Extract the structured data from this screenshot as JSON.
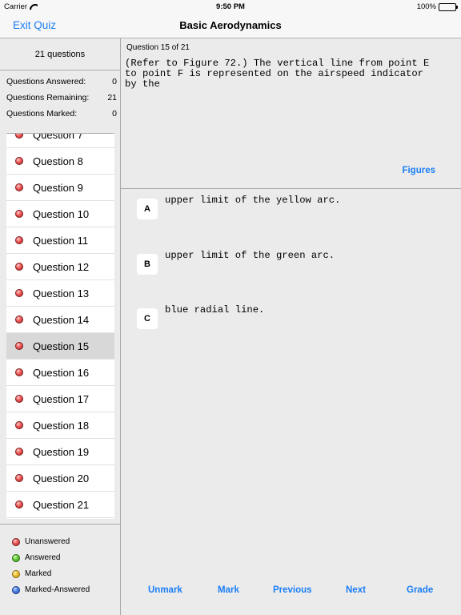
{
  "status_bar": {
    "carrier": "Carrier",
    "time": "9:50 PM",
    "battery": "100%",
    "battery_level": 1.0,
    "wifi_icon": "wifi-icon",
    "battery_icon": "battery-icon"
  },
  "nav": {
    "exit_label": "Exit Quiz",
    "title": "Basic Aerodynamics"
  },
  "sidebar": {
    "question_count": "21 questions",
    "stats": [
      {
        "label": "Questions Answered:",
        "value": "0"
      },
      {
        "label": "Questions Remaining:",
        "value": "21"
      },
      {
        "label": "Questions Marked:",
        "value": "0"
      }
    ],
    "questions": [
      "Question 7",
      "Question 8",
      "Question 9",
      "Question 10",
      "Question 11",
      "Question 12",
      "Question 13",
      "Question 14",
      "Question 15",
      "Question 16",
      "Question 17",
      "Question 18",
      "Question 19",
      "Question 20",
      "Question 21"
    ],
    "selected_question": "Question 15",
    "legend": [
      {
        "label": "Unanswered",
        "color": "red"
      },
      {
        "label": "Answered",
        "color": "green"
      },
      {
        "label": "Marked",
        "color": "yellow"
      },
      {
        "label": "Marked-Answered",
        "color": "blue"
      }
    ]
  },
  "question": {
    "number_label": "Question 15 of 21",
    "text_lines": [
      "(Refer to Figure 72.) The vertical line from point E",
      "to point F is represented on the airspeed indicator",
      "by the"
    ],
    "figures_label": "Figures"
  },
  "answers": [
    {
      "letter": "A",
      "text": "upper limit of the yellow arc."
    },
    {
      "letter": "B",
      "text": "upper limit of the green arc."
    },
    {
      "letter": "C",
      "text": "blue radial line."
    }
  ],
  "toolbar": {
    "unmark": "Unmark",
    "mark": "Mark",
    "previous": "Previous",
    "next": "Next",
    "grade": "Grade"
  },
  "colors": {
    "accent": "#1a7ef5",
    "background": "#ebebeb",
    "selected_row": "#d8d8d8"
  }
}
